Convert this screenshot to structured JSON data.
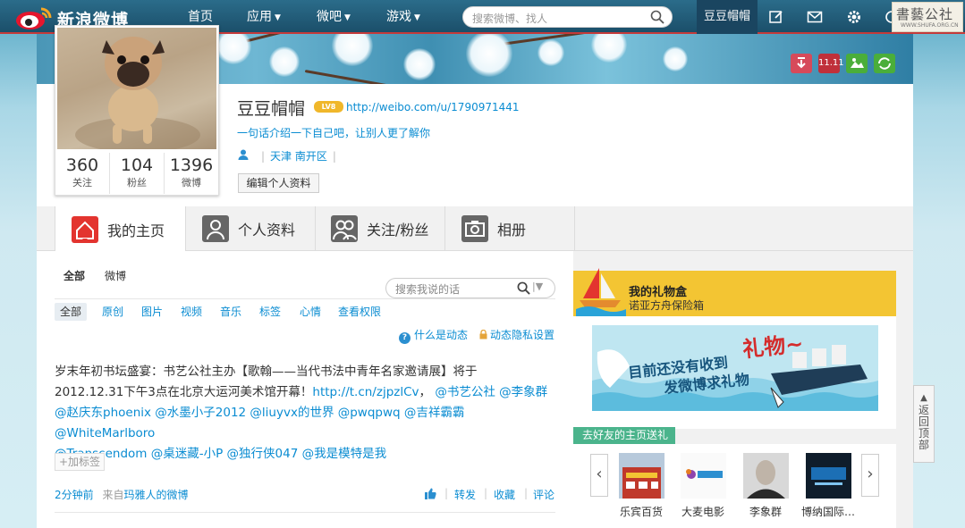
{
  "topbar": {
    "logo_text": "新浪微博",
    "nav": [
      {
        "label": "首页",
        "has_arrow": false
      },
      {
        "label": "应用",
        "has_arrow": true
      },
      {
        "label": "微吧",
        "has_arrow": true
      },
      {
        "label": "游戏",
        "has_arrow": true
      }
    ],
    "search_placeholder": "搜索微博、找人",
    "user_tab": "豆豆帽帽",
    "icons": [
      "compose-icon",
      "mail-icon",
      "gear-icon",
      "message-icon"
    ],
    "watermark_text": "書藝公社",
    "watermark_url": "WWW.SHUFA.ORG.CN"
  },
  "banner_icons": [
    {
      "name": "download-icon",
      "label": "",
      "color": "#d64a5a"
    },
    {
      "name": "calendar-icon",
      "label": "11.11",
      "color": "#c0303a"
    },
    {
      "name": "photo-icon",
      "label": "",
      "color": "#4aae3a"
    },
    {
      "name": "refresh-icon",
      "label": "",
      "color": "#4aae3a"
    }
  ],
  "profile": {
    "name": "豆豆帽帽",
    "level_badge": "LV8",
    "url": "http://weibo.com/u/1790971441",
    "bio": "一句话介绍一下自己吧，让别人更了解你",
    "location": "天津 南开区",
    "location_sep": "|",
    "edit_label": "编辑个人资料",
    "stats": [
      {
        "num": "360",
        "label": "关注"
      },
      {
        "num": "104",
        "label": "粉丝"
      },
      {
        "num": "1396",
        "label": "微博"
      }
    ]
  },
  "tabs": [
    {
      "label": "我的主页",
      "icon": "home-icon"
    },
    {
      "label": "个人资料",
      "icon": "person-icon"
    },
    {
      "label": "关注/粉丝",
      "icon": "people-icon"
    },
    {
      "label": "相册",
      "icon": "camera-icon"
    }
  ],
  "feed": {
    "top_tabs": [
      "全部",
      "微博"
    ],
    "search_placeholder": "搜索我说的话",
    "filters": [
      "全部",
      "原创",
      "图片",
      "视频",
      "音乐",
      "标签",
      "心情",
      "查看权限"
    ],
    "help_links": [
      "什么是动态",
      "动态隐私设置"
    ],
    "post": {
      "line1_text": "岁末年初书坛盛宴：书艺公社主办【歌翰——当代书法中青年名家邀请展】将于",
      "line2_text": "2012.12.31下午3点在北京大运河美术馆开幕！",
      "line2_link": "http://t.cn/zjpzlCv",
      "line2_sep": "，",
      "line2_mentions": "@书艺公社 @李象群",
      "line3_mentions": "@赵庆东phoenix @水墨小子2012 @liuyvx的世界 @pwqpwq @吉祥霸霸 @WhiteMarlboro",
      "line4_mentions": "@Transcendom @桌迷藏-小P @独行侠047 @我是模特是我"
    },
    "add_tag": "+加标签",
    "time": "2分钟前",
    "source_prefix": "来自",
    "source": "玛雅人的微博",
    "actions": [
      "转发",
      "收藏",
      "评论"
    ]
  },
  "sidebar": {
    "gift_title": "我的礼物盒",
    "gift_sub": "诺亚方舟保险箱",
    "gift_banner_1": "目前还没有收到",
    "gift_banner_2": "礼物~",
    "gift_banner_3": "发微博求礼物",
    "friends_tag": "去好友的主页送礼",
    "friends": [
      "乐宾百货",
      "大麦电影",
      "李象群",
      "博纳国际…"
    ]
  },
  "back_to_top": "返回顶部",
  "colors": {
    "link": "#0a8cd2",
    "topbar": "#1b4f6a",
    "gift_head": "#f3c533",
    "friends_tag": "#4bb48c"
  }
}
